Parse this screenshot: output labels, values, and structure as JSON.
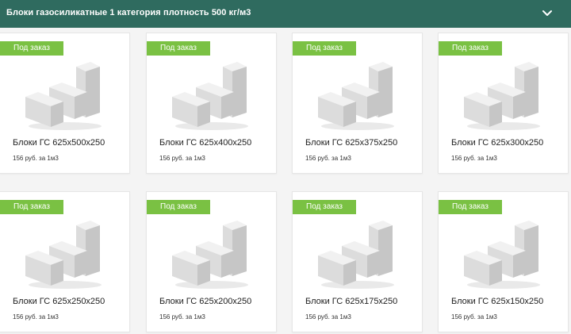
{
  "header": {
    "title": "Блоки газосиликатные 1 категория плотность 500 кг/м3",
    "toggle_icon": "chevron-down-icon"
  },
  "colors": {
    "header_bg": "#2f6b5f",
    "badge_bg": "#7ac143",
    "block_light": "#f1f1f1",
    "block_mid": "#dcdcdc",
    "block_dark": "#c6c6c6"
  },
  "products": [
    {
      "badge": "Под заказ",
      "name": "Блоки ГС 625x500x250",
      "price": "156 руб. за 1м3"
    },
    {
      "badge": "Под заказ",
      "name": "Блоки ГС 625x400x250",
      "price": "156 руб. за 1м3"
    },
    {
      "badge": "Под заказ",
      "name": "Блоки ГС 625x375x250",
      "price": "156 руб. за 1м3"
    },
    {
      "badge": "Под заказ",
      "name": "Блоки ГС 625x300x250",
      "price": "156 руб. за 1м3"
    },
    {
      "badge": "Под заказ",
      "name": "Блоки ГС 625x250x250",
      "price": "156 руб. за 1м3"
    },
    {
      "badge": "Под заказ",
      "name": "Блоки ГС 625x200x250",
      "price": "156 руб. за 1м3"
    },
    {
      "badge": "Под заказ",
      "name": "Блоки ГС 625x175x250",
      "price": "156 руб. за 1м3"
    },
    {
      "badge": "Под заказ",
      "name": "Блоки ГС 625x150x250",
      "price": "156 руб. за 1м3"
    }
  ]
}
